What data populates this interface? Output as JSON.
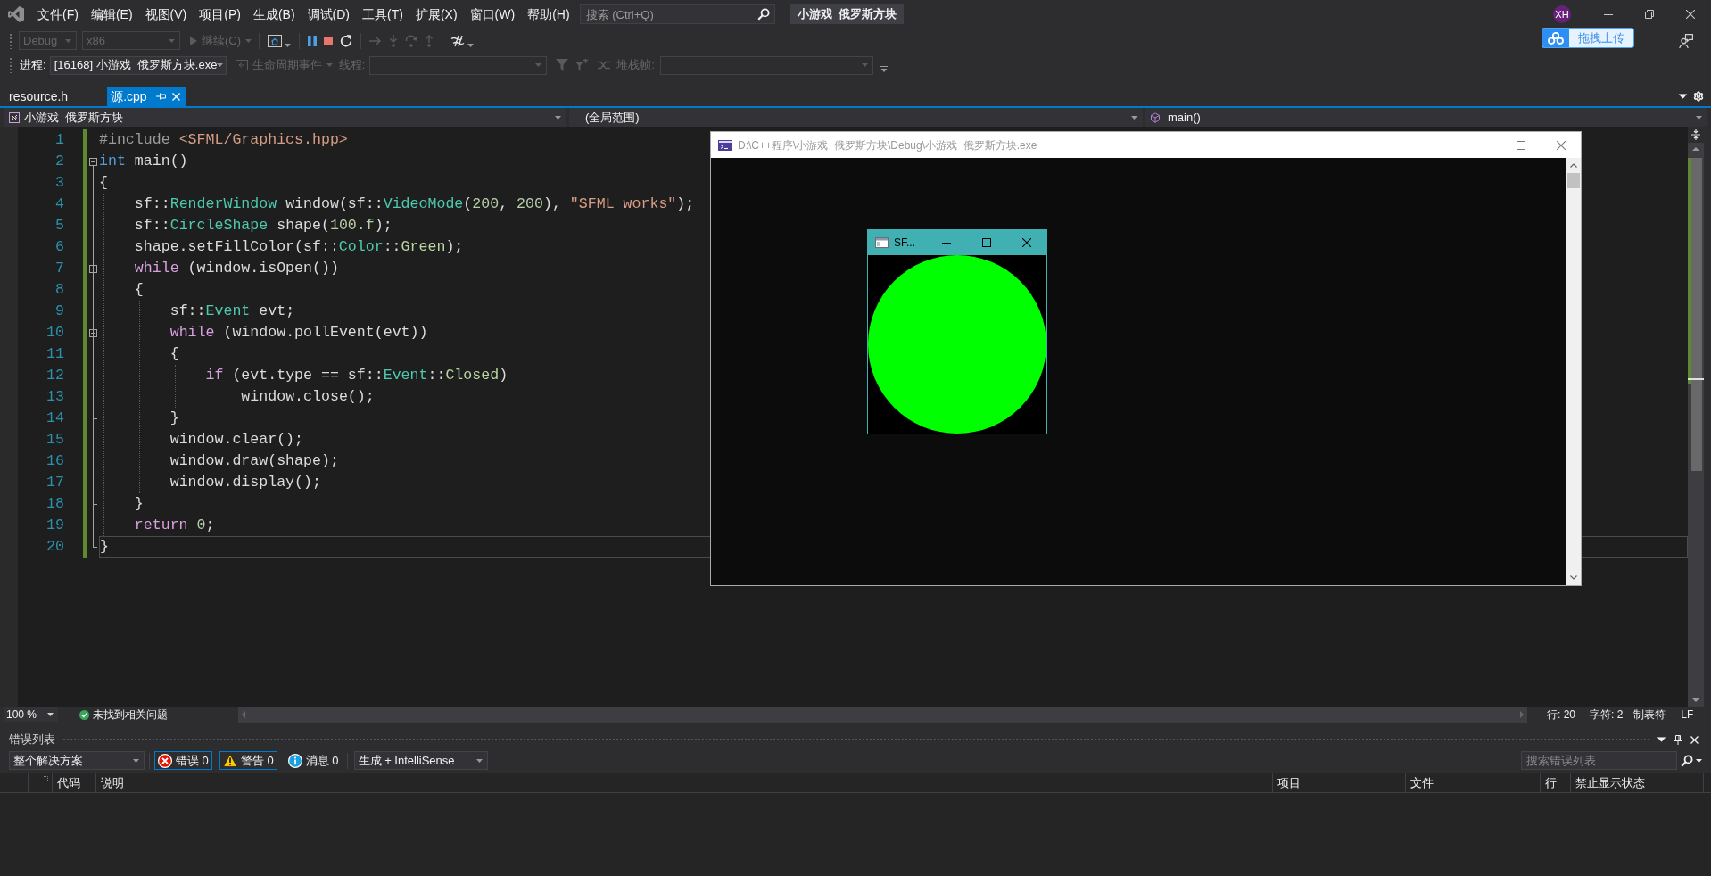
{
  "menu_bar": {
    "items": [
      "文件(F)",
      "编辑(E)",
      "视图(V)",
      "项目(P)",
      "生成(B)",
      "调试(D)",
      "工具(T)",
      "扩展(X)",
      "窗口(W)",
      "帮助(H)"
    ],
    "search": {
      "placeholder": "搜索 (Ctrl+Q)"
    },
    "solution_name": "小游戏  俄罗斯方块",
    "account_initials": "XH"
  },
  "upload_widget": {
    "label": "拖拽上传"
  },
  "debug_toolbar": {
    "configuration": {
      "value": "Debug",
      "disabled": true
    },
    "platform": {
      "value": "x86",
      "disabled": true
    },
    "continue": {
      "label": "继续(C)",
      "disabled": true
    },
    "tool_groups": [
      {
        "tools": [
          {
            "kind": "screenshot",
            "disabled": false
          }
        ]
      },
      {
        "tools": [
          {
            "kind": "pause",
            "disabled": false
          },
          {
            "kind": "stop",
            "disabled": false
          },
          {
            "kind": "restart",
            "disabled": false
          }
        ]
      },
      {
        "tools": [
          {
            "kind": "show_next",
            "disabled": true
          },
          {
            "kind": "step_into",
            "disabled": true
          },
          {
            "kind": "step_over",
            "disabled": true
          },
          {
            "kind": "step_out",
            "disabled": true
          }
        ]
      },
      {
        "tools": [
          {
            "kind": "threads",
            "disabled": false
          }
        ]
      }
    ]
  },
  "process_toolbar": {
    "process": {
      "label": "进程:",
      "value": "[16168] 小游戏  俄罗斯方块.exe",
      "disabled": false
    },
    "lifecycle": {
      "label": "生命周期事件",
      "disabled": true
    },
    "thread": {
      "label": "线程:",
      "disabled": true
    },
    "stack_frame": {
      "label": "堆栈帧:",
      "disabled": true
    }
  },
  "tabs": [
    {
      "label": "resource.h",
      "selected": false
    },
    {
      "label": "源.cpp",
      "selected": true
    }
  ],
  "nav_bar": {
    "project": "小游戏  俄罗斯方块",
    "scope": "(全局范围)",
    "member": "main()"
  },
  "editor": {
    "lines": [
      {
        "number": "1",
        "changed": true,
        "current": false,
        "tokens": [
          {
            "text": "#include",
            "kind": "pp"
          },
          {
            "text": " <SFML/Graphics.hpp>",
            "kind": "inc"
          }
        ]
      },
      {
        "number": "2",
        "changed": true,
        "current": false,
        "expanded": true,
        "tokens": [
          {
            "text": "int",
            "kind": "kw"
          },
          {
            "text": " main()",
            "kind": "p"
          }
        ]
      },
      {
        "number": "3",
        "changed": true,
        "current": false,
        "tokens": [
          {
            "text": "{",
            "kind": "p"
          }
        ]
      },
      {
        "number": "4",
        "changed": true,
        "current": false,
        "tokens": [
          {
            "text": "    sf::",
            "kind": "p"
          },
          {
            "text": "RenderWindow",
            "kind": "type"
          },
          {
            "text": " window(sf::",
            "kind": "p"
          },
          {
            "text": "VideoMode",
            "kind": "type"
          },
          {
            "text": "(",
            "kind": "p"
          },
          {
            "text": "200",
            "kind": "num"
          },
          {
            "text": ", ",
            "kind": "p"
          },
          {
            "text": "200",
            "kind": "num"
          },
          {
            "text": "), ",
            "kind": "p"
          },
          {
            "text": "\"SFML works\"",
            "kind": "str"
          },
          {
            "text": ");",
            "kind": "p"
          }
        ]
      },
      {
        "number": "5",
        "changed": true,
        "current": false,
        "tokens": [
          {
            "text": "    sf::",
            "kind": "p"
          },
          {
            "text": "CircleShape",
            "kind": "type"
          },
          {
            "text": " shape(",
            "kind": "p"
          },
          {
            "text": "100.f",
            "kind": "num"
          },
          {
            "text": ");",
            "kind": "p"
          }
        ]
      },
      {
        "number": "6",
        "changed": true,
        "current": false,
        "tokens": [
          {
            "text": "    shape.setFillColor(sf::",
            "kind": "p"
          },
          {
            "text": "Color",
            "kind": "type"
          },
          {
            "text": "::",
            "kind": "p"
          },
          {
            "text": "Green",
            "kind": "enm"
          },
          {
            "text": ");",
            "kind": "p"
          }
        ]
      },
      {
        "number": "7",
        "changed": true,
        "current": false,
        "expanded": true,
        "tokens": [
          {
            "text": "    while",
            "kind": "ctl"
          },
          {
            "text": " (window.isOpen())",
            "kind": "p"
          }
        ]
      },
      {
        "number": "8",
        "changed": true,
        "current": false,
        "tokens": [
          {
            "text": "    {",
            "kind": "p"
          }
        ]
      },
      {
        "number": "9",
        "changed": true,
        "current": false,
        "tokens": [
          {
            "text": "        sf::",
            "kind": "p"
          },
          {
            "text": "Event",
            "kind": "type"
          },
          {
            "text": " evt;",
            "kind": "p"
          }
        ]
      },
      {
        "number": "10",
        "changed": true,
        "current": false,
        "expanded": true,
        "tokens": [
          {
            "text": "        while",
            "kind": "ctl"
          },
          {
            "text": " (window.pollEvent(evt))",
            "kind": "p"
          }
        ]
      },
      {
        "number": "11",
        "changed": true,
        "current": false,
        "tokens": [
          {
            "text": "        {",
            "kind": "p"
          }
        ]
      },
      {
        "number": "12",
        "changed": true,
        "current": false,
        "tokens": [
          {
            "text": "            if",
            "kind": "ctl"
          },
          {
            "text": " (evt.type == sf::",
            "kind": "p"
          },
          {
            "text": "Event",
            "kind": "type"
          },
          {
            "text": "::",
            "kind": "p"
          },
          {
            "text": "Closed",
            "kind": "enm"
          },
          {
            "text": ")",
            "kind": "p"
          }
        ]
      },
      {
        "number": "13",
        "changed": true,
        "current": false,
        "tokens": [
          {
            "text": "                window.close();",
            "kind": "p"
          }
        ]
      },
      {
        "number": "14",
        "changed": true,
        "current": false,
        "tokens": [
          {
            "text": "        }",
            "kind": "p"
          }
        ]
      },
      {
        "number": "15",
        "changed": true,
        "current": false,
        "tokens": [
          {
            "text": "        window.clear();",
            "kind": "p"
          }
        ]
      },
      {
        "number": "16",
        "changed": true,
        "current": false,
        "tokens": [
          {
            "text": "        window.draw(shape);",
            "kind": "p"
          }
        ]
      },
      {
        "number": "17",
        "changed": true,
        "current": false,
        "tokens": [
          {
            "text": "        window.display();",
            "kind": "p"
          }
        ]
      },
      {
        "number": "18",
        "changed": true,
        "current": false,
        "tokens": [
          {
            "text": "    }",
            "kind": "p"
          }
        ]
      },
      {
        "number": "19",
        "changed": true,
        "current": false,
        "tokens": [
          {
            "text": "    return",
            "kind": "ctl"
          },
          {
            "text": " 0",
            "kind": "num"
          },
          {
            "text": ";",
            "kind": "p"
          }
        ]
      },
      {
        "number": "20",
        "changed": true,
        "current": true,
        "tokens": [
          {
            "text": "}",
            "kind": "p"
          }
        ]
      }
    ]
  },
  "editor_status": {
    "zoom": "100 %",
    "issues": "未找到相关问题",
    "line": "行: 20",
    "column": "字符: 2",
    "indentation": "制表符",
    "line_ending": "LF"
  },
  "error_list": {
    "title": "错误列表",
    "scope": "整个解决方案",
    "filters": [
      {
        "kind": "error",
        "label": "错误 0",
        "selected": true
      },
      {
        "kind": "warning",
        "label": "警告 0",
        "selected": true
      },
      {
        "kind": "message",
        "label": "消息 0",
        "selected": false
      }
    ],
    "source": "生成 + IntelliSense",
    "search": {
      "placeholder": "搜索错误列表"
    },
    "columns": [
      "代码",
      "说明",
      "项目",
      "文件",
      "行",
      "禁止显示状态"
    ]
  },
  "console_window": {
    "title": "D:\\C++程序\\小游戏  俄罗斯方块\\Debug\\小游戏  俄罗斯方块.exe",
    "active": false
  },
  "sfml_window": {
    "title": "SF...",
    "active": true
  }
}
